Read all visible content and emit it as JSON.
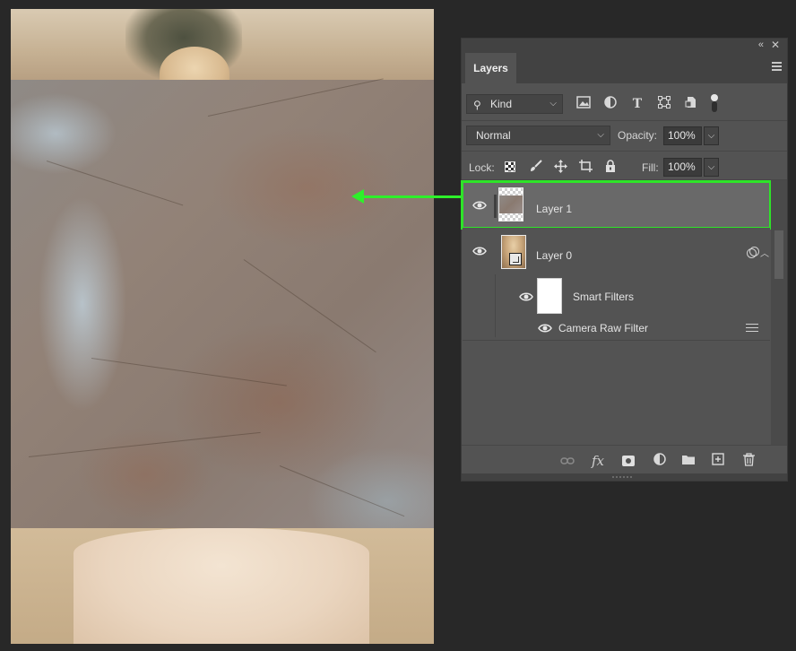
{
  "panel": {
    "tab_label": "Layers",
    "collapse_glyph": "«",
    "close_glyph": "✕"
  },
  "filter": {
    "kind_label": "Kind",
    "icons": [
      "image-filter-icon",
      "adjustment-filter-icon",
      "type-filter-icon",
      "shape-filter-icon",
      "smart-object-filter-icon"
    ]
  },
  "blend": {
    "mode": "Normal",
    "opacity_label": "Opacity:",
    "opacity_value": "100%"
  },
  "lock": {
    "label": "Lock:",
    "fill_label": "Fill:",
    "fill_value": "100%"
  },
  "layers": [
    {
      "name": "Layer 1",
      "selected": true,
      "visible": true
    },
    {
      "name": "Layer 0",
      "selected": false,
      "visible": true,
      "smart_object": true
    }
  ],
  "smart_filters": {
    "label": "Smart Filters",
    "filters": [
      {
        "name": "Camera Raw Filter"
      }
    ]
  },
  "colors": {
    "highlight": "#2ee428",
    "panel_bg": "#535353",
    "selected_row": "#696969"
  }
}
